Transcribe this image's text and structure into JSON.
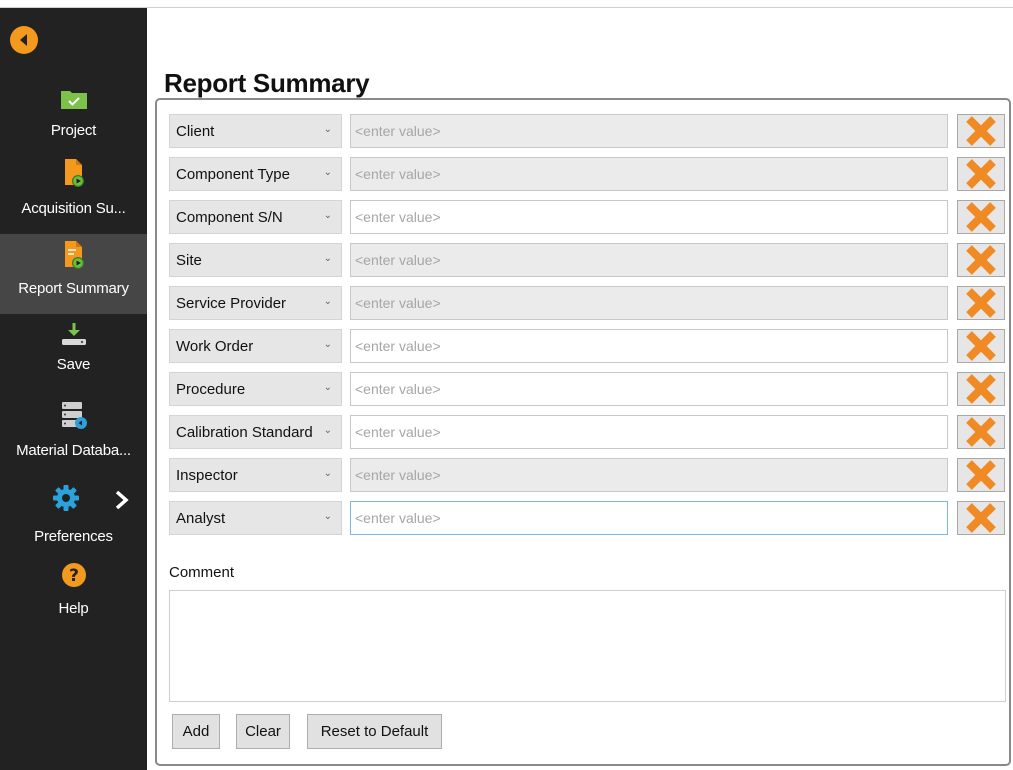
{
  "sidebar": {
    "items": [
      {
        "label": "Project",
        "icon": "folder-check-icon"
      },
      {
        "label": "Acquisition Su...",
        "icon": "file-play-icon"
      },
      {
        "label": "Report Summary",
        "icon": "report-play-icon",
        "active": true
      },
      {
        "label": "Save",
        "icon": "save-download-icon"
      },
      {
        "label": "Material Databa...",
        "icon": "database-icon"
      },
      {
        "label": "Preferences",
        "icon": "gear-icon"
      },
      {
        "label": "Help",
        "icon": "help-icon"
      }
    ],
    "accent_color": "#f39a1e",
    "active_bg": "#464646"
  },
  "main": {
    "title": "Report Summary",
    "fields": [
      {
        "field": "Client",
        "value": "",
        "placeholder": "<enter value>"
      },
      {
        "field": "Component Type",
        "value": "",
        "placeholder": "<enter value>"
      },
      {
        "field": "Component S/N",
        "value": "",
        "placeholder": "<enter value>"
      },
      {
        "field": "Site",
        "value": "",
        "placeholder": "<enter value>"
      },
      {
        "field": "Service Provider",
        "value": "",
        "placeholder": "<enter value>"
      },
      {
        "field": "Work Order",
        "value": "",
        "placeholder": "<enter value>"
      },
      {
        "field": "Procedure",
        "value": "",
        "placeholder": "<enter value>"
      },
      {
        "field": "Calibration Standard",
        "value": "",
        "placeholder": "<enter value>"
      },
      {
        "field": "Inspector",
        "value": "",
        "placeholder": "<enter value>"
      },
      {
        "field": "Analyst",
        "value": "",
        "placeholder": "<enter value>"
      }
    ],
    "comment_label": "Comment",
    "comment_value": "",
    "buttons": {
      "add": "Add",
      "clear": "Clear",
      "reset": "Reset to Default"
    },
    "delete_icon_color": "#f08a24"
  }
}
